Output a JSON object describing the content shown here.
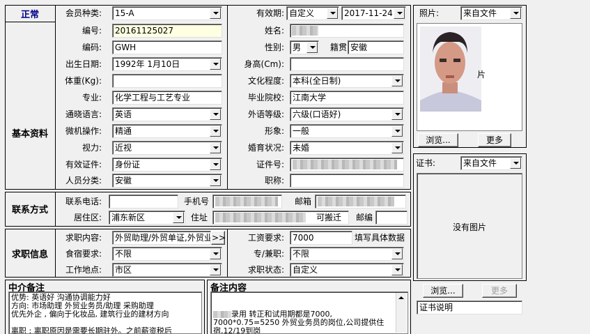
{
  "status": "正常",
  "member": {
    "type_label": "会员种类:",
    "type_value": "15-A"
  },
  "validity": {
    "label": "有效期:",
    "mode": "自定义",
    "date": "2017-11-24"
  },
  "sections": {
    "basic": "基本资料",
    "contact": "联系方式",
    "job": "求职信息",
    "agent_note": "中介备注",
    "note": "备注内容"
  },
  "basic": {
    "id_label": "编号:",
    "id_value": "20161125027",
    "code_label": "编码:",
    "code_value": "GWH",
    "birth_label": "出生日期:",
    "birth_value": "1992年 1月10日",
    "weight_label": "体重(Kg):",
    "weight_value": "",
    "major_label": "专业:",
    "major_value": "化学工程与工艺专业",
    "lang_label": "通晓语言:",
    "lang_value": "英语",
    "computer_label": "微机操作:",
    "computer_value": "精通",
    "vision_label": "视力:",
    "vision_value": "近视",
    "idtype_label": "有效证件:",
    "idtype_value": "身份证",
    "category_label": "人员分类:",
    "category_value": "安徽",
    "name_label": "姓名:",
    "gender_label": "性别:",
    "gender_value": "男",
    "native_label": "籍贯",
    "native_value": "安徽",
    "height_label": "身高(Cm):",
    "height_value": "",
    "edu_label": "文化程度:",
    "edu_value": "本科(全日制)",
    "school_label": "毕业院校:",
    "school_value": "江南大学",
    "lang_level_label": "外语等级:",
    "lang_level_value": "六级(口语好)",
    "image_label": "形象:",
    "image_value": "一般",
    "marital_label": "婚育状况:",
    "marital_value": "未婚",
    "idno_label": "证件号:",
    "title_label": "职称:",
    "title_value": ""
  },
  "contact": {
    "phone_label": "联系电话:",
    "phone_value": "",
    "mobile_label": "手机号",
    "email_label": "邮箱",
    "district_label": "居住区:",
    "district_value": "浦东新区",
    "address_label": "住址",
    "address_suffix": "可搬迁",
    "zip_label": "邮编",
    "zip_value": ""
  },
  "job": {
    "content_label": "求职内容:",
    "content_value": "外贸助理/外贸单证,外贸业",
    "more_btn": ">>",
    "salary_label": "工资要求:",
    "salary_value": "7000",
    "salary_note": "填写具体数据",
    "board_label": "食宿要求:",
    "board_value": "不限",
    "fulltime_label": "专/兼职:",
    "fulltime_value": "不限",
    "location_label": "工作地点:",
    "location_value": "市区",
    "status_label": "求职状态:",
    "status_value": "自定义"
  },
  "agent_note_lines": [
    "优势: 英语好 沟通协调能力好",
    "方向: 市场助理 外贸业务员/助理 采购助理",
    "优先外企 , 偏向于化妆品, 建筑行业的建材方向",
    "",
    "离职 : 离职原因是需要长期驻外。之前薪资税后"
  ],
  "note_lines": [
    "",
    "",
    "录用 转正和试用期都是7000,",
    "7000*0.75=5250 外贸业务员的岗位,公司提供住",
    "宿,12/19到岗"
  ],
  "photo": {
    "label": "照片:",
    "source": "来自文件",
    "browse": "浏览...",
    "more": "更多",
    "overlay": "片"
  },
  "certificate": {
    "label": "证书:",
    "source": "来自文件",
    "empty": "没有图片",
    "browse": "浏览...",
    "more": "更多",
    "desc": "证书说明"
  }
}
